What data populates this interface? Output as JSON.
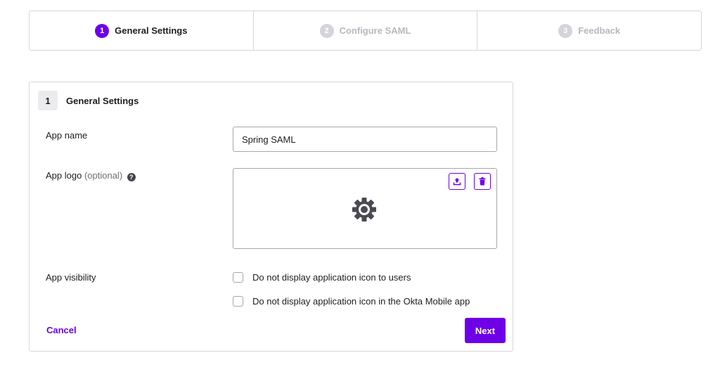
{
  "stepper": {
    "steps": [
      {
        "num": "1",
        "label": "General Settings"
      },
      {
        "num": "2",
        "label": "Configure SAML"
      },
      {
        "num": "3",
        "label": "Feedback"
      }
    ]
  },
  "section": {
    "num": "1",
    "title": "General Settings"
  },
  "fields": {
    "app_name_label": "App name",
    "app_name_value": "Spring SAML",
    "app_logo_label": "App logo",
    "app_logo_optional": "(optional)",
    "app_visibility_label": "App visibility",
    "visibility_options": [
      "Do not display application icon to users",
      "Do not display application icon in the Okta Mobile app"
    ]
  },
  "icons": {
    "help": "question-circle-icon",
    "upload": "upload-icon",
    "delete": "trash-icon",
    "logo_placeholder": "gear-icon"
  },
  "actions": {
    "cancel_label": "Cancel",
    "next_label": "Next"
  },
  "colors": {
    "accent": "#6e00e8",
    "inactive_step": "#d4d4d9",
    "border": "#d7d7dc"
  }
}
